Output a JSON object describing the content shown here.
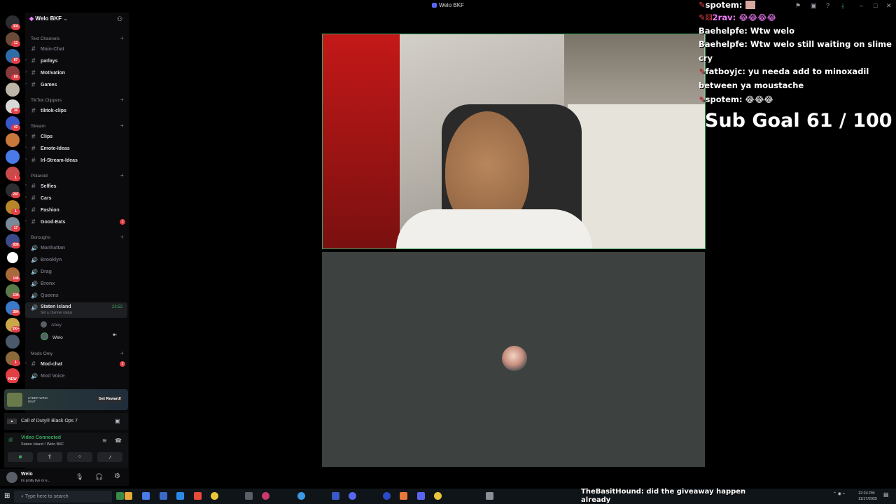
{
  "window": {
    "title": "Welo BKF"
  },
  "server": {
    "name": "Welo BKF"
  },
  "rail_badges": [
    "301",
    "12",
    "87",
    "69",
    "36",
    "42",
    "1",
    "247",
    "1",
    "17",
    "930",
    "148",
    "100",
    "384",
    "2K+",
    "1",
    "NEW"
  ],
  "categories": {
    "text": "Text Channels",
    "tiktok": "TikTok Clippers",
    "stream": "Stream",
    "polaroid": "Polaroid",
    "boroughs": "Boroughs",
    "mods": "Mods Only"
  },
  "channels": {
    "main_chat": "Main-Chat",
    "parlays": "parlays",
    "motivation": "Motivation",
    "games": "Games",
    "tiktok_clips": "tiktok-clips",
    "clips": "Clips",
    "emote_ideas": "Emote-Ideas",
    "irl_ideas": "Irl-Stream-Ideas",
    "selfies": "Selfies",
    "cars": "Cars",
    "fashion": "Fashion",
    "good_eats": "Good-Eats",
    "good_eats_badge": "1",
    "manhattan": "Manhattan",
    "brooklyn": "Brooklyn",
    "drag": "Drag",
    "bronx": "Bronx",
    "queens": "Queens",
    "staten_island": "Staten Island",
    "staten_time": "23:52",
    "staten_status": "Set a channel status",
    "voice_user_1": "Abey",
    "voice_user_2": "Welo",
    "mod_chat": "Mod-chat",
    "mod_chat_badge": "2",
    "mod_voice": "Mod Voice"
  },
  "promo": {
    "text": "ZYBER WINS WAIT",
    "button": "Get Reward!"
  },
  "activity": {
    "game": "Call of Duty® Black Ops 7"
  },
  "voice_panel": {
    "status": "Video Connected",
    "location": "Staten Island / Welo BKF"
  },
  "user": {
    "name": "Welo",
    "status": "im prolly live or e..."
  },
  "chat": [
    {
      "name": "spotem:",
      "text": ""
    },
    {
      "name": "2rav:",
      "text": "😂😂😂😂"
    },
    {
      "name": "Baehelpfe:",
      "text": "Wtw welo"
    },
    {
      "name": "Baehelpfe:",
      "text": "Wtw welo still waiting on slime"
    },
    {
      "name": "",
      "text": "cry"
    },
    {
      "name": "fatboyjc:",
      "text": "yu needa add to minoxadil"
    },
    {
      "name": "",
      "text": "between ya moustache"
    },
    {
      "name": "spotem:",
      "text": "😂😂😂"
    }
  ],
  "sub_goal": "Sub Goal  61 / 100",
  "taskbar": {
    "search_placeholder": "Type here to search",
    "ticker": "TheBasitHound: did the giveaway happen already",
    "clock": "12:24 PM",
    "date": "11/17/2025"
  },
  "colors": {
    "accent": "#5865f2",
    "voice_green": "#3ba55d",
    "badge_red": "#e23f45"
  }
}
